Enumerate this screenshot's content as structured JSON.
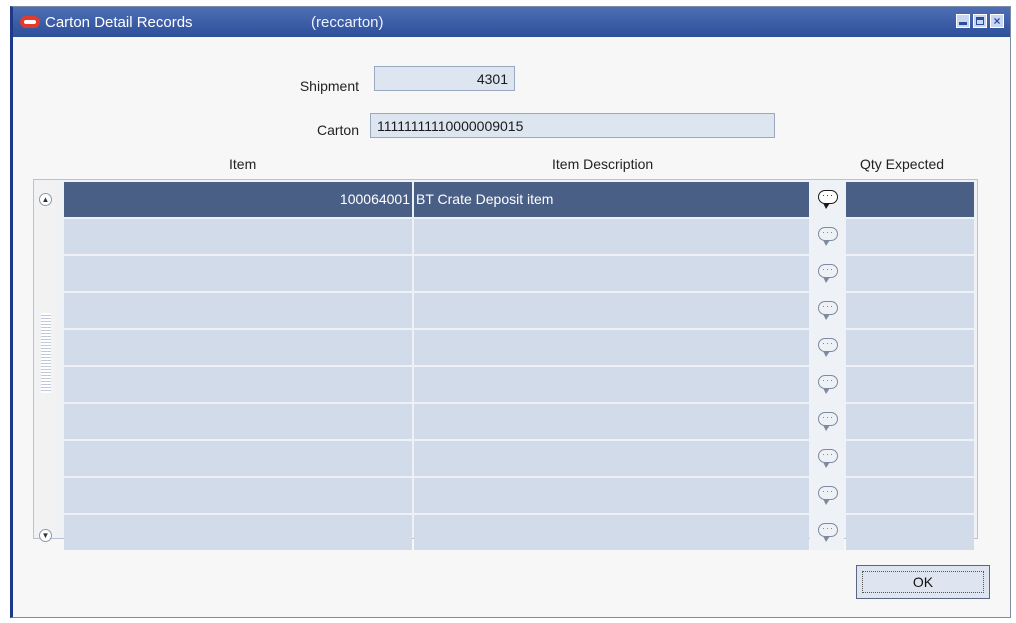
{
  "window": {
    "title": "Carton Detail Records",
    "subtitle": "(reccarton)",
    "controls": {
      "minimize": "minimize-icon",
      "maximize": "maximize-icon",
      "close": "close-icon"
    }
  },
  "form": {
    "shipment_label": "Shipment",
    "shipment_value": "4301",
    "carton_label": "Carton",
    "carton_value": "11111111110000009015"
  },
  "table": {
    "headers": {
      "item": "Item",
      "description": "Item Description",
      "qty": "Qty Expected"
    },
    "rows": [
      {
        "item": "100064001",
        "description": "BT Crate Deposit item",
        "qty": ""
      },
      {
        "item": "",
        "description": "",
        "qty": ""
      },
      {
        "item": "",
        "description": "",
        "qty": ""
      },
      {
        "item": "",
        "description": "",
        "qty": ""
      },
      {
        "item": "",
        "description": "",
        "qty": ""
      },
      {
        "item": "",
        "description": "",
        "qty": ""
      },
      {
        "item": "",
        "description": "",
        "qty": ""
      },
      {
        "item": "",
        "description": "",
        "qty": ""
      },
      {
        "item": "",
        "description": "",
        "qty": ""
      },
      {
        "item": "",
        "description": "",
        "qty": ""
      }
    ],
    "selected_row": 0
  },
  "actions": {
    "ok_label": "OK"
  },
  "colors": {
    "titlebar": "#2d4f9a",
    "selected_row": "#4a5f86",
    "row": "#d2dbea",
    "oracle_red": "#e23b2e"
  }
}
